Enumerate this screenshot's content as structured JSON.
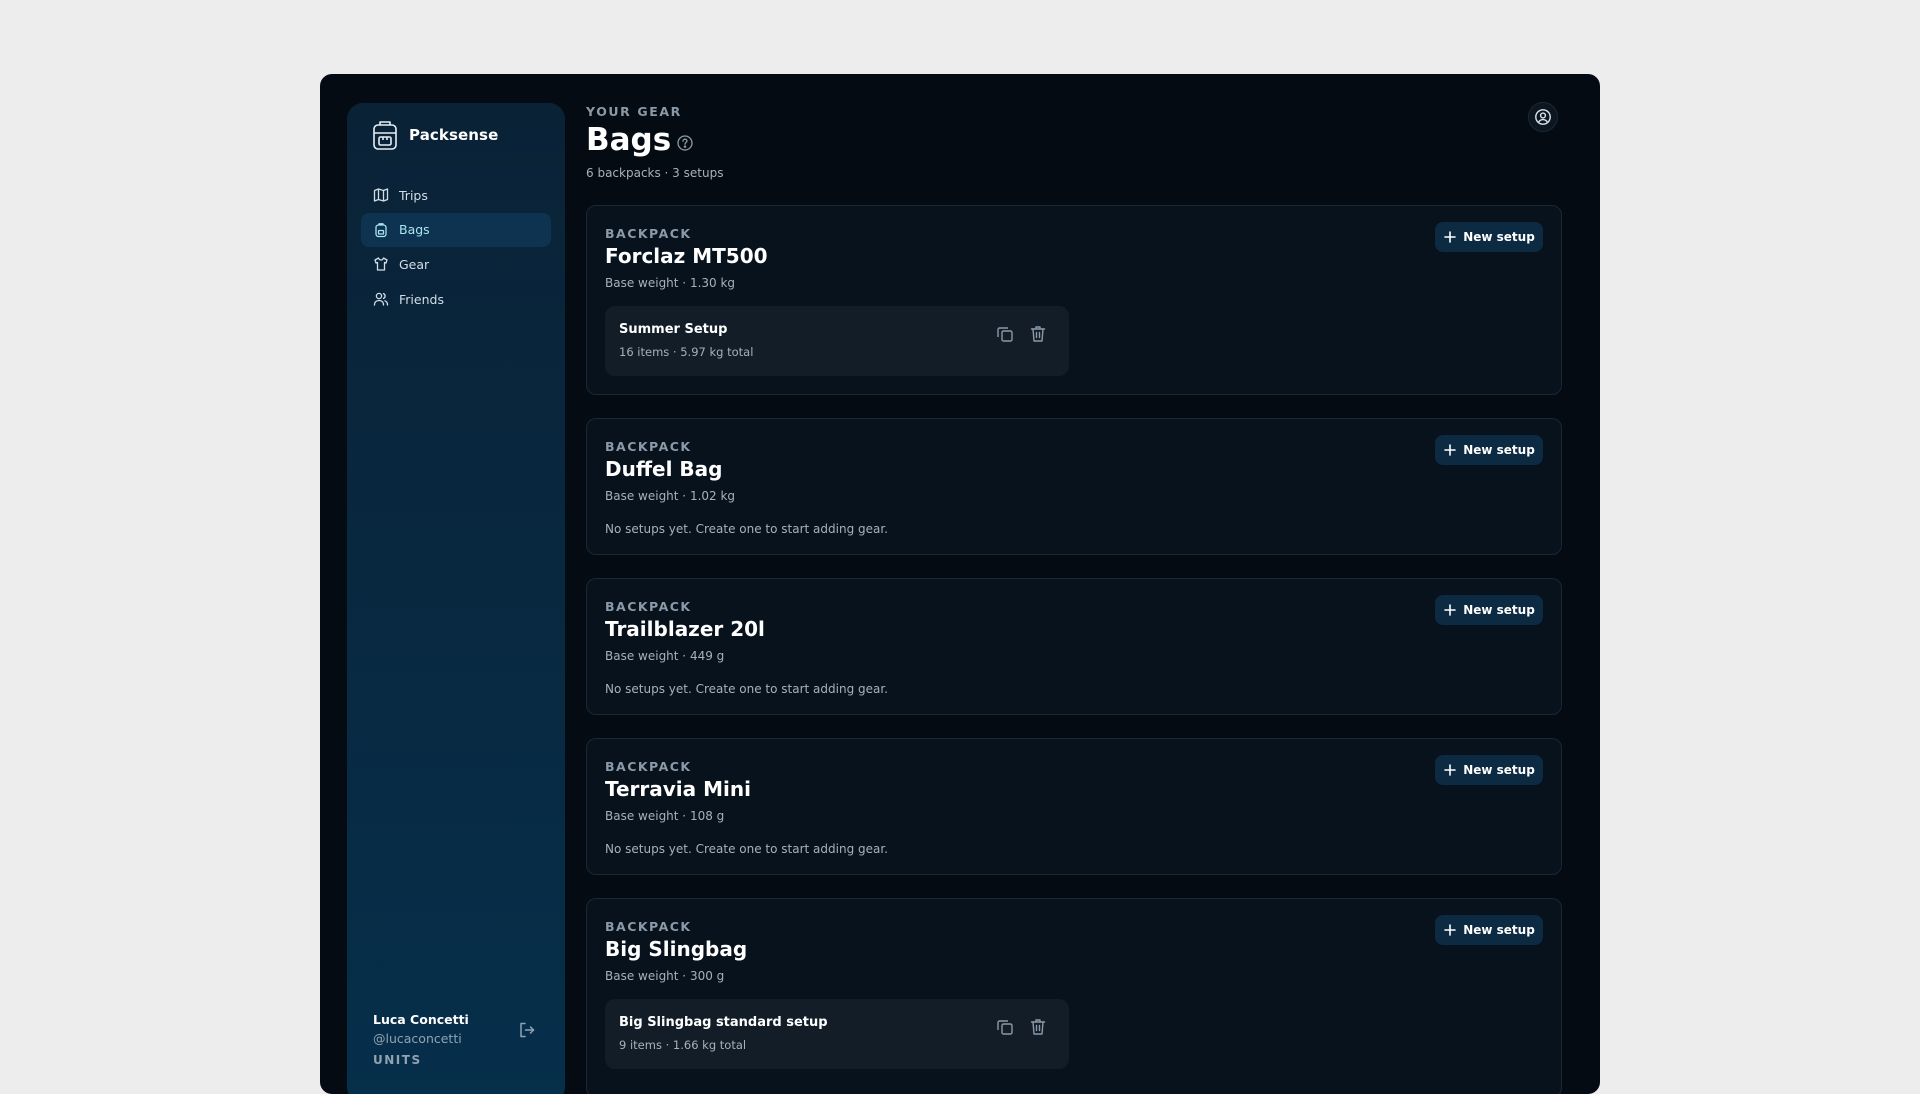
{
  "app": {
    "name": "Packsense"
  },
  "nav": [
    {
      "label": "Trips",
      "icon": "map-icon",
      "active": false
    },
    {
      "label": "Bags",
      "icon": "bag-icon",
      "active": true
    },
    {
      "label": "Gear",
      "icon": "shirt-icon",
      "active": false
    },
    {
      "label": "Friends",
      "icon": "users-icon",
      "active": false
    }
  ],
  "user": {
    "name": "Luca Concetti",
    "handle": "@lucaconcetti"
  },
  "units_label": "UNITS",
  "header": {
    "eyebrow": "YOUR GEAR",
    "title": "Bags",
    "subtitle": "6 backpacks · 3 setups"
  },
  "new_setup_label": "New setup",
  "bags": [
    {
      "label": "BACKPACK",
      "name": "Forclaz MT500",
      "weight": "Base weight · 1.30 kg",
      "setups": [
        {
          "name": "Summer Setup",
          "meta": "16 items · 5.97 kg total"
        }
      ]
    },
    {
      "label": "BACKPACK",
      "name": "Duffel Bag",
      "weight": "Base weight · 1.02 kg",
      "empty": "No setups yet. Create one to start adding gear."
    },
    {
      "label": "BACKPACK",
      "name": "Trailblazer 20l",
      "weight": "Base weight · 449 g",
      "empty": "No setups yet. Create one to start adding gear."
    },
    {
      "label": "BACKPACK",
      "name": "Terravia Mini",
      "weight": "Base weight · 108 g",
      "empty": "No setups yet. Create one to start adding gear."
    },
    {
      "label": "BACKPACK",
      "name": "Big Slingbag",
      "weight": "Base weight · 300 g",
      "setups": [
        {
          "name": "Big Slingbag standard setup",
          "meta": "9 items · 1.66 kg total"
        }
      ]
    }
  ],
  "colors": {
    "accent": "#a9e4f0",
    "background": "#050b12",
    "sidebar": "#062f4b",
    "page": "#ededee"
  }
}
